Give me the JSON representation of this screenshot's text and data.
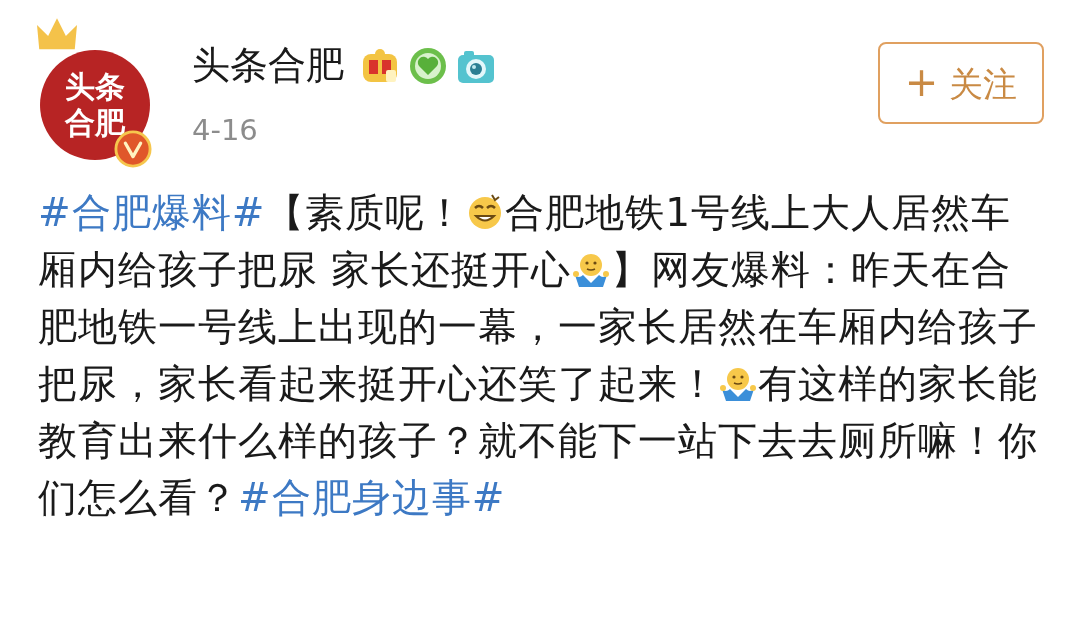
{
  "author": {
    "avatar_lines": [
      "头条",
      "合肥"
    ],
    "name": "头条合肥",
    "date": "4-16"
  },
  "follow_button": {
    "icon": "+",
    "label": "关注"
  },
  "post": [
    {
      "kind": "hashtag",
      "text": "#合肥爆料#"
    },
    {
      "kind": "text",
      "text": "【素质呢！"
    },
    {
      "kind": "grin"
    },
    {
      "kind": "text",
      "text": "合肥地铁1号线上大人居然车厢内给孩子把尿 家长还挺开心"
    },
    {
      "kind": "shrug"
    },
    {
      "kind": "text",
      "text": "】网友爆料：昨天在合肥地铁一号线上出现的一幕，一家长居然在车厢内给孩子把尿，家长看起来挺开心还笑了起来！"
    },
    {
      "kind": "shrug"
    },
    {
      "kind": "text",
      "text": "有这样的家长能教育出来什么样的孩子？就不能下一站下去去厕所嘛！你们怎么看？"
    },
    {
      "kind": "hashtag",
      "text": "#合肥身边事#"
    }
  ]
}
